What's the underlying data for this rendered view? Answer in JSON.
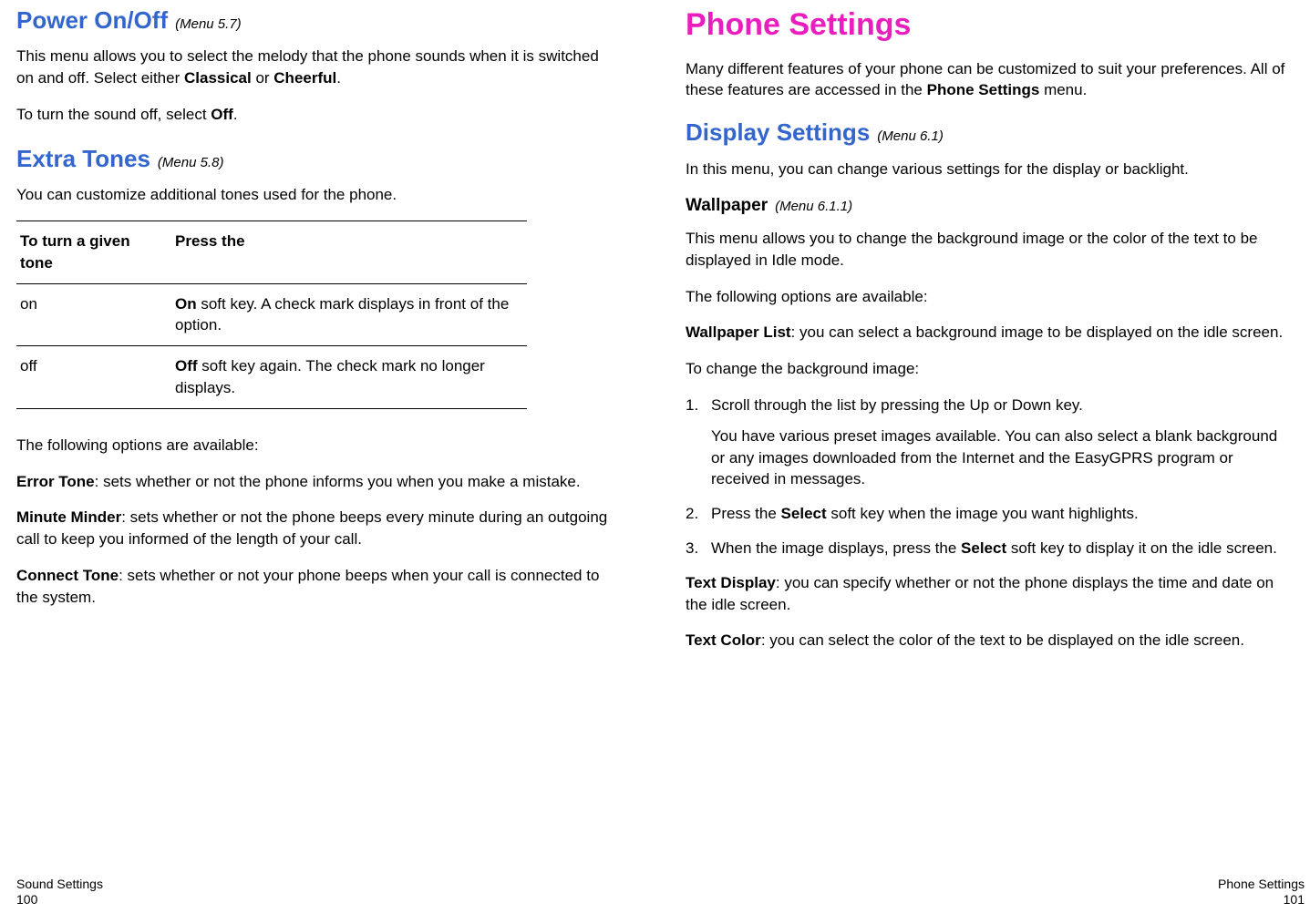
{
  "left": {
    "section1": {
      "title": "Power On/Off",
      "menu": "(Menu 5.7)",
      "p1_a": "This menu allows you to select the melody that the phone sounds when it is switched on and off. Select either ",
      "p1_b1": "Classical",
      "p1_or": " or ",
      "p1_b2": "Cheerful",
      "p1_end": ".",
      "p2_a": "To turn the sound off, select ",
      "p2_b": "Off",
      "p2_end": "."
    },
    "section2": {
      "title": "Extra Tones",
      "menu": "(Menu 5.8)",
      "intro": "You can customize additional tones used for the phone.",
      "table": {
        "h1": "To turn a given tone",
        "h2": "Press the",
        "r1c1": "on",
        "r1c2_b": "On",
        "r1c2_t": " soft key. A check mark displays in front of the option.",
        "r2c1": "off",
        "r2c2_b": "Off",
        "r2c2_t": " soft key again. The check mark no longer displays."
      },
      "opts_intro": "The following options are available:",
      "opt1_b": "Error Tone",
      "opt1_t": ": sets whether or not the phone informs you when you make a mistake.",
      "opt2_b": "Minute Minder",
      "opt2_t": ": sets whether or not the phone beeps every minute during an outgoing call to keep you informed of the length of your call.",
      "opt3_b": "Connect Tone",
      "opt3_t": ": sets whether or not your phone beeps when your call is connected to the system."
    },
    "footer": {
      "label": "Sound Settings",
      "page": "100"
    }
  },
  "right": {
    "title": "Phone Settings",
    "intro_a": "Many different features of your phone can be customized to suit your preferences. All of these features are accessed in the ",
    "intro_b": "Phone Settings",
    "intro_c": " menu.",
    "display": {
      "title": "Display Settings",
      "menu": "(Menu 6.1)",
      "intro": "In this menu, you can change various settings for the display or backlight."
    },
    "wallpaper": {
      "title": "Wallpaper",
      "menu": "(Menu 6.1.1)",
      "p1": "This menu allows you to change the background image or the color of the text to be displayed in Idle mode.",
      "p2": "The following options are available:",
      "wl_b": "Wallpaper List",
      "wl_t": ": you can select a background image to be displayed on the idle screen.",
      "p3": "To change the background image:",
      "steps": {
        "s1": "Scroll through the list by pressing the Up or Down key.",
        "s1sub": "You have various preset images available. You can also select a blank background or any images downloaded from the Internet and the EasyGPRS program or received in messages.",
        "s2_a": "Press the ",
        "s2_b": "Select",
        "s2_c": " soft key when the image you want highlights.",
        "s3_a": "When the image displays, press the ",
        "s3_b": "Select",
        "s3_c": " soft key to display it on the idle screen."
      },
      "td_b": "Text Display",
      "td_t": ": you can specify whether or not the phone displays the time and date on the idle screen.",
      "tc_b": "Text Color",
      "tc_t": ": you can select the color of the text to be displayed on the idle screen."
    },
    "footer": {
      "label": "Phone Settings",
      "page": "101"
    }
  }
}
